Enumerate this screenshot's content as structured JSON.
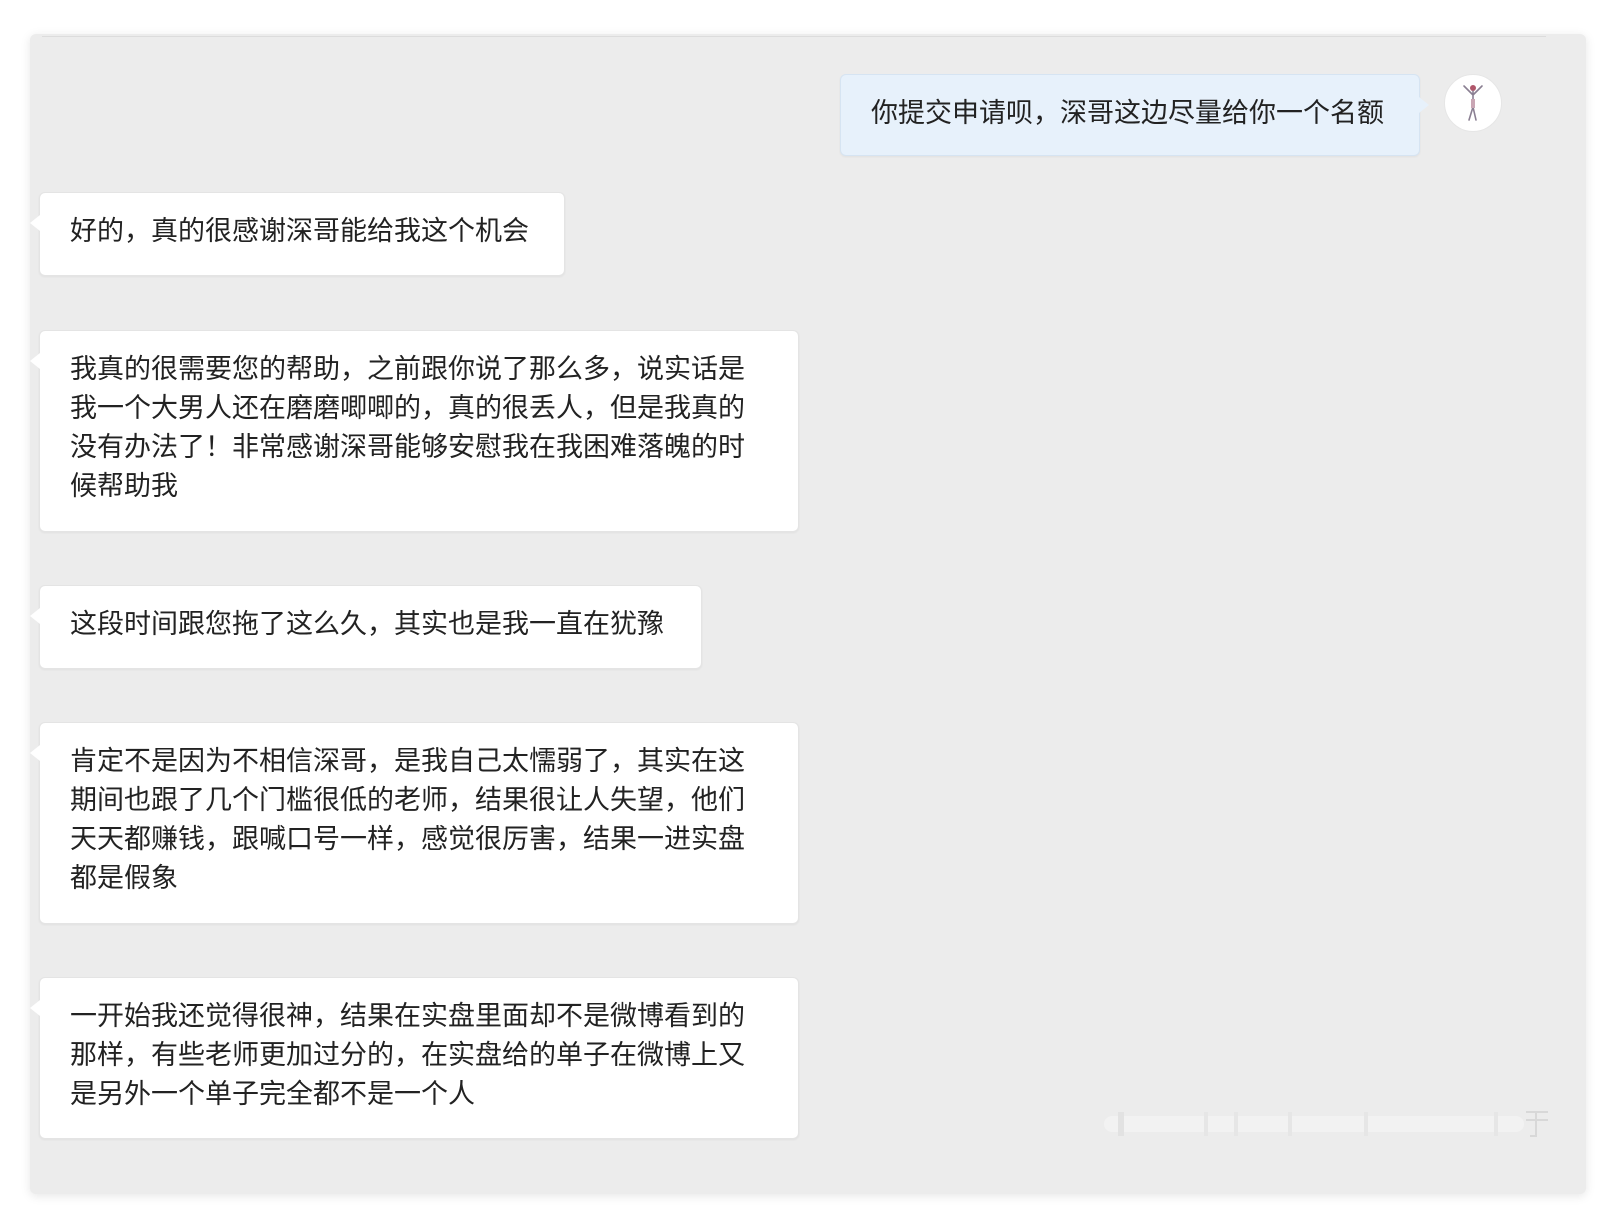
{
  "conversation": {
    "outgoing": [
      {
        "text": "你提交申请呗，深哥这边尽量给你一个名额"
      }
    ],
    "incoming": [
      {
        "text": "好的，真的很感谢深哥能给我这个机会"
      },
      {
        "text": "我真的很需要您的帮助，之前跟你说了那么多，说实话是我一个大男人还在磨磨唧唧的，真的很丢人，但是我真的没有办法了！非常感谢深哥能够安慰我在我困难落魄的时候帮助我"
      },
      {
        "text": "这段时间跟您拖了这么久，其实也是我一直在犹豫"
      },
      {
        "text": "肯定不是因为不相信深哥，是我自己太懦弱了，其实在这期间也跟了几个门槛很低的老师，结果很让人失望，他们天天都赚钱，跟喊口号一样，感觉很厉害，结果一进实盘都是假象"
      },
      {
        "text": "一开始我还觉得很神，结果在实盘里面却不是微博看到的那样，有些老师更加过分的，在实盘给的单子在微博上又是另外一个单子完全都不是一个人"
      }
    ]
  },
  "avatar": {
    "icon": "person-silhouette-icon"
  },
  "colors": {
    "panel_bg": "#ececec",
    "incoming_bubble": "#ffffff",
    "outgoing_bubble": "#e7f1fb",
    "text": "#222222"
  }
}
